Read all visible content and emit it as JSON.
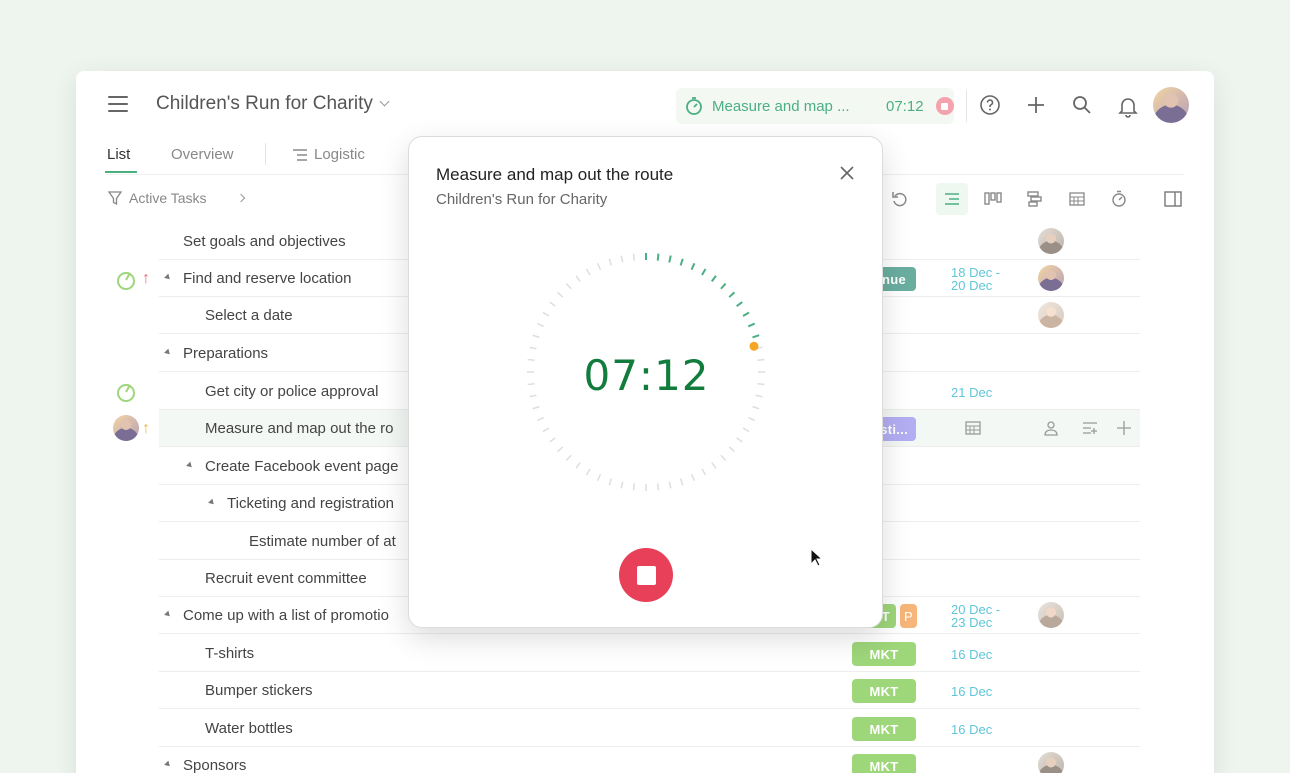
{
  "project": {
    "title": "Children's Run for Charity"
  },
  "running_timer": {
    "label": "Measure and map ...",
    "time": "07:12"
  },
  "tabs": [
    {
      "label": "List",
      "active": true
    },
    {
      "label": "Overview",
      "active": false
    },
    {
      "label": "Logistic",
      "active": false
    }
  ],
  "filter": {
    "label": "Active Tasks"
  },
  "rows": [
    {
      "name": "Set goals and objectives"
    },
    {
      "name": "Find and reserve location",
      "tag": "nue",
      "date1": "18 Dec -",
      "date2": "20 Dec"
    },
    {
      "name": "Select a date"
    },
    {
      "name": "Preparations"
    },
    {
      "name": "Get city or police approval",
      "date1": "21 Dec"
    },
    {
      "name": "Measure and map out the ro",
      "tag": "isti..."
    },
    {
      "name": "Create Facebook event page"
    },
    {
      "name": "Ticketing and registration"
    },
    {
      "name": "Estimate number of at"
    },
    {
      "name": "Recruit event committee"
    },
    {
      "name": "Come up with a list of promotio",
      "tag": "T",
      "tag2": "P",
      "date1": "20 Dec -",
      "date2": "23 Dec"
    },
    {
      "name": "T-shirts",
      "tag": "MKT",
      "date1": "16 Dec"
    },
    {
      "name": "Bumper stickers",
      "tag": "MKT",
      "date1": "16 Dec"
    },
    {
      "name": "Water bottles",
      "tag": "MKT",
      "date1": "16 Dec"
    },
    {
      "name": "Sponsors",
      "tag": "MKT"
    }
  ],
  "modal": {
    "title": "Measure and map out the route",
    "subtitle": "Children's Run for Charity",
    "time": "07:12",
    "elapsed_fraction_of_minute": 0.2
  },
  "colors": {
    "accent": "#4caf82",
    "stop": "#e84059",
    "date": "#5fc6d8",
    "mkt_tag": "#9ed67a",
    "location_tag": "#6aaea0",
    "logistic_tag": "#b3aef3",
    "p_tag": "#f6b67a"
  },
  "icons": [
    "menu-icon",
    "timer-icon",
    "help-icon",
    "plus-icon",
    "search-icon",
    "bell-icon",
    "filter-icon",
    "undo-icon",
    "list-view-icon",
    "board-view-icon",
    "gantt-view-icon",
    "calendar-view-icon",
    "time-view-icon",
    "side-panel-icon",
    "close-icon",
    "stop-icon",
    "calendar-icon",
    "person-icon",
    "subtasks-icon"
  ]
}
